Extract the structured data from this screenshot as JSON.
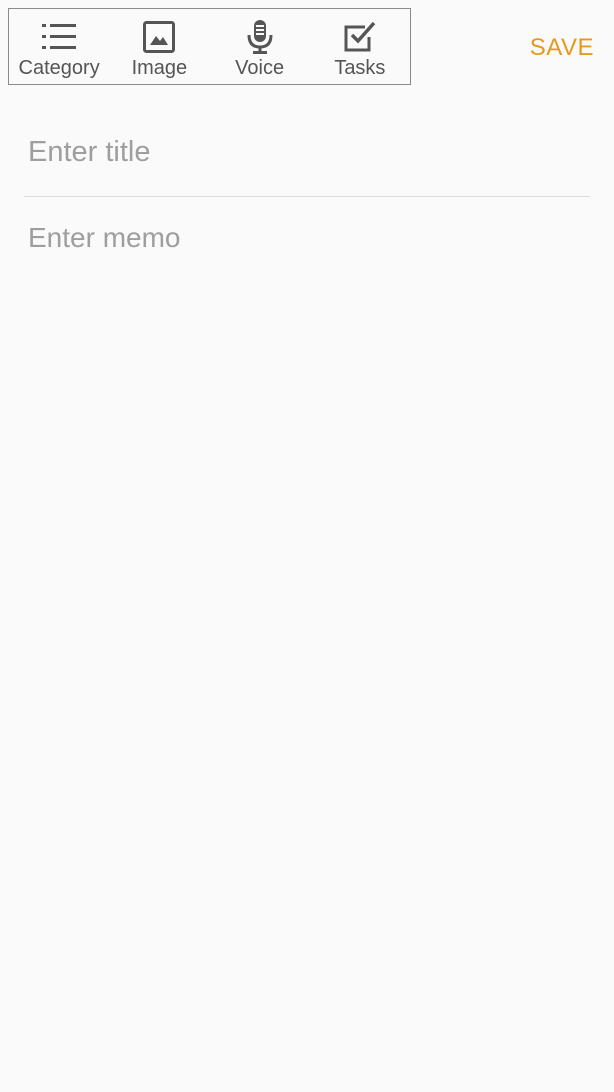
{
  "toolbar": {
    "items": [
      {
        "label": "Category",
        "icon": "list-icon"
      },
      {
        "label": "Image",
        "icon": "image-icon"
      },
      {
        "label": "Voice",
        "icon": "microphone-icon"
      },
      {
        "label": "Tasks",
        "icon": "checkbox-icon"
      }
    ]
  },
  "save_label": "SAVE",
  "title_field": {
    "placeholder": "Enter title",
    "value": ""
  },
  "memo_field": {
    "placeholder": "Enter memo",
    "value": ""
  },
  "colors": {
    "accent": "#e69a1c",
    "icon": "#555555",
    "background": "#fafafa"
  }
}
